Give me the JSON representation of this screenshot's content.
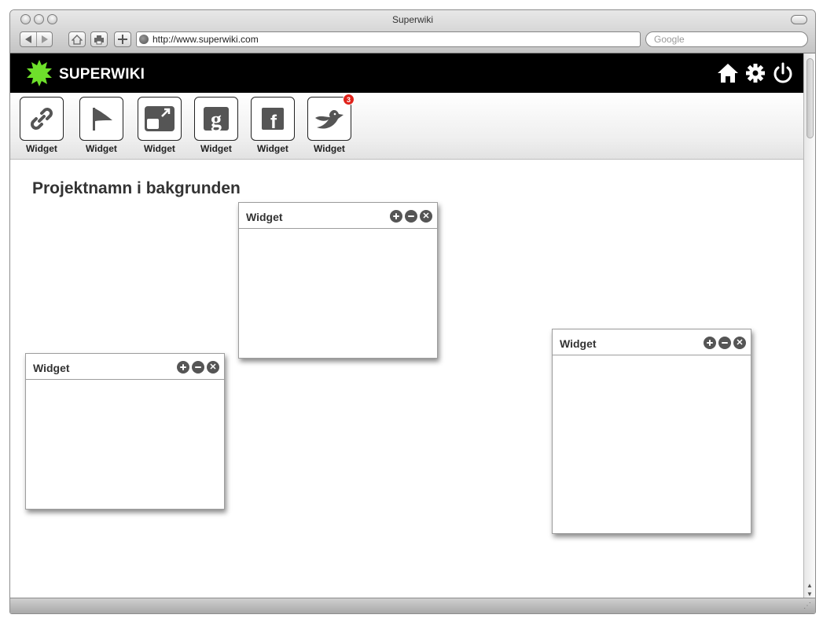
{
  "browser": {
    "window_title": "Superwiki",
    "url": "http://www.superwiki.com",
    "search_placeholder": "Google"
  },
  "app": {
    "brand": "SUPERWIKI",
    "accent_color": "#6ee02b",
    "header_icons": [
      "home-icon",
      "gear-icon",
      "power-icon"
    ]
  },
  "toolbar": {
    "items": [
      {
        "label": "Widget",
        "icon": "link-icon"
      },
      {
        "label": "Widget",
        "icon": "flag-icon"
      },
      {
        "label": "Widget",
        "icon": "external-window-icon"
      },
      {
        "label": "Widget",
        "icon": "google-icon"
      },
      {
        "label": "Widget",
        "icon": "facebook-icon"
      },
      {
        "label": "Widget",
        "icon": "twitter-bird-icon",
        "badge": "3"
      }
    ]
  },
  "main": {
    "project_title": "Projektnamn i bakgrunden",
    "widgets": [
      {
        "title": "Widget"
      },
      {
        "title": "Widget"
      },
      {
        "title": "Widget"
      }
    ]
  }
}
